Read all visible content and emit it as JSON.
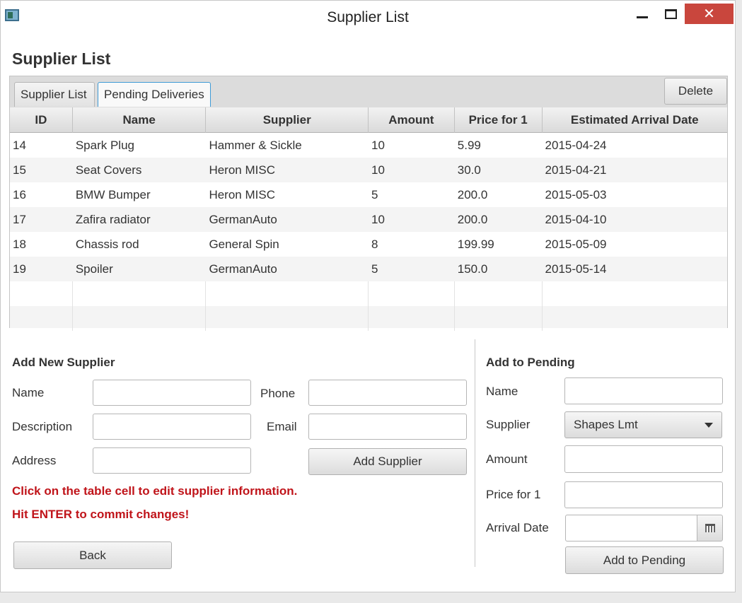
{
  "window": {
    "title": "Supplier List"
  },
  "page": {
    "title": "Supplier List"
  },
  "tabs": [
    {
      "label": "Supplier List"
    },
    {
      "label": "Pending Deliveries"
    }
  ],
  "toolbar": {
    "delete_label": "Delete"
  },
  "table": {
    "columns": [
      "ID",
      "Name",
      "Supplier",
      "Amount",
      "Price for 1",
      "Estimated Arrival Date"
    ],
    "rows": [
      {
        "id": "14",
        "name": "Spark Plug",
        "supplier": "Hammer & Sickle",
        "amount": "10",
        "price": "5.99",
        "arrival": "2015-04-24"
      },
      {
        "id": "15",
        "name": "Seat Covers",
        "supplier": "Heron MISC",
        "amount": "10",
        "price": "30.0",
        "arrival": "2015-04-21"
      },
      {
        "id": "16",
        "name": "BMW Bumper",
        "supplier": "Heron MISC",
        "amount": "5",
        "price": "200.0",
        "arrival": "2015-05-03"
      },
      {
        "id": "17",
        "name": "Zafira radiator",
        "supplier": "GermanAuto",
        "amount": "10",
        "price": "200.0",
        "arrival": "2015-04-10"
      },
      {
        "id": "18",
        "name": "Chassis rod",
        "supplier": "General Spin",
        "amount": "8",
        "price": "199.99",
        "arrival": "2015-05-09"
      },
      {
        "id": "19",
        "name": "Spoiler",
        "supplier": "GermanAuto",
        "amount": "5",
        "price": "150.0",
        "arrival": "2015-05-14"
      }
    ]
  },
  "add_supplier": {
    "title": "Add New Supplier",
    "name_label": "Name",
    "description_label": "Description",
    "address_label": "Address",
    "phone_label": "Phone",
    "email_label": "Email",
    "name_value": "",
    "description_value": "",
    "address_value": "",
    "phone_value": "",
    "email_value": "",
    "add_button": "Add Supplier",
    "hint_1": "Click on the table cell to edit supplier information.",
    "hint_2": "Hit ENTER to commit changes!",
    "back_button": "Back"
  },
  "add_pending": {
    "title": "Add to Pending",
    "name_label": "Name",
    "supplier_label": "Supplier",
    "amount_label": "Amount",
    "price_label": "Price for 1",
    "arrival_label": "Arrival Date",
    "supplier_selected": "Shapes Lmt",
    "name_value": "",
    "amount_value": "",
    "price_value": "",
    "arrival_value": "",
    "add_button": "Add to Pending"
  }
}
